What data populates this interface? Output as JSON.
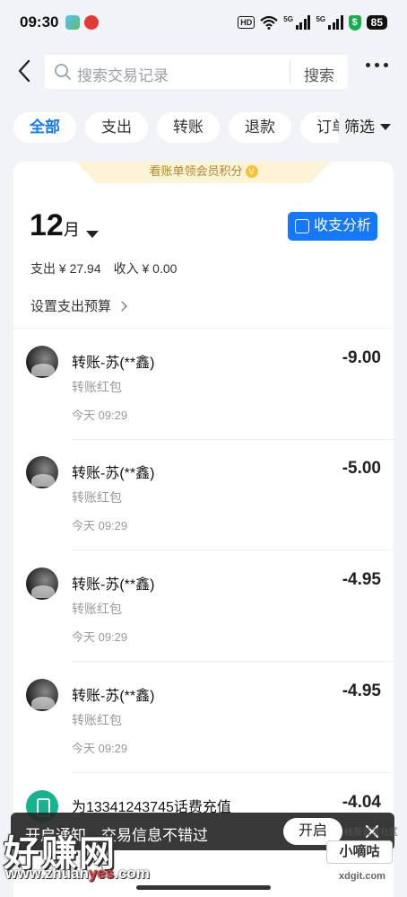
{
  "status_bar": {
    "time": "09:30",
    "hd_label": "HD",
    "signal_label_1": "5G",
    "signal_label_2": "5G",
    "battery": "85",
    "shield_glyph": "$"
  },
  "header": {
    "search_placeholder": "搜索交易记录",
    "search_button": "搜索"
  },
  "tabs": [
    {
      "label": "全部",
      "active": true
    },
    {
      "label": "支出",
      "active": false
    },
    {
      "label": "转账",
      "active": false
    },
    {
      "label": "退款",
      "active": false
    },
    {
      "label": "订单",
      "active": false
    }
  ],
  "filter_label": "筛选",
  "banner": {
    "text": "看账单领会员积分",
    "coin_glyph": "V"
  },
  "month": {
    "number": "12",
    "unit": "月"
  },
  "analysis_button": "收支分析",
  "summary": {
    "expense": "支出 ¥ 27.94",
    "income": "收入 ¥ 0.00"
  },
  "budget_link": "设置支出预算",
  "transactions": [
    {
      "title": "转账-苏(**鑫)",
      "subtitle": "转账红包",
      "time": "今天 09:29",
      "amount": "-9.00",
      "icon": "avatar"
    },
    {
      "title": "转账-苏(**鑫)",
      "subtitle": "转账红包",
      "time": "今天 09:29",
      "amount": "-5.00",
      "icon": "avatar"
    },
    {
      "title": "转账-苏(**鑫)",
      "subtitle": "转账红包",
      "time": "今天 09:29",
      "amount": "-4.95",
      "icon": "avatar"
    },
    {
      "title": "转账-苏(**鑫)",
      "subtitle": "转账红包",
      "time": "今天 09:29",
      "amount": "-4.95",
      "icon": "avatar"
    },
    {
      "title": "为13341243745话费充值",
      "subtitle": "",
      "time": "",
      "amount": "-4.04",
      "icon": "phone-icon"
    }
  ],
  "toast": {
    "message": "开启通知，交易信息不错过",
    "button": "开启"
  },
  "watermark": {
    "big": "好赚网",
    "url_prefix": "www.zhuan",
    "url_accent": "yes",
    "url_suffix": ".com",
    "right_top": "线报首发社区",
    "right_logo": "小嘀咕",
    "right_url": "xdgit.com"
  },
  "colors": {
    "accent": "#1677ff",
    "banner_bg": "#fdf3d6",
    "phone_icon": "#17b38f"
  }
}
